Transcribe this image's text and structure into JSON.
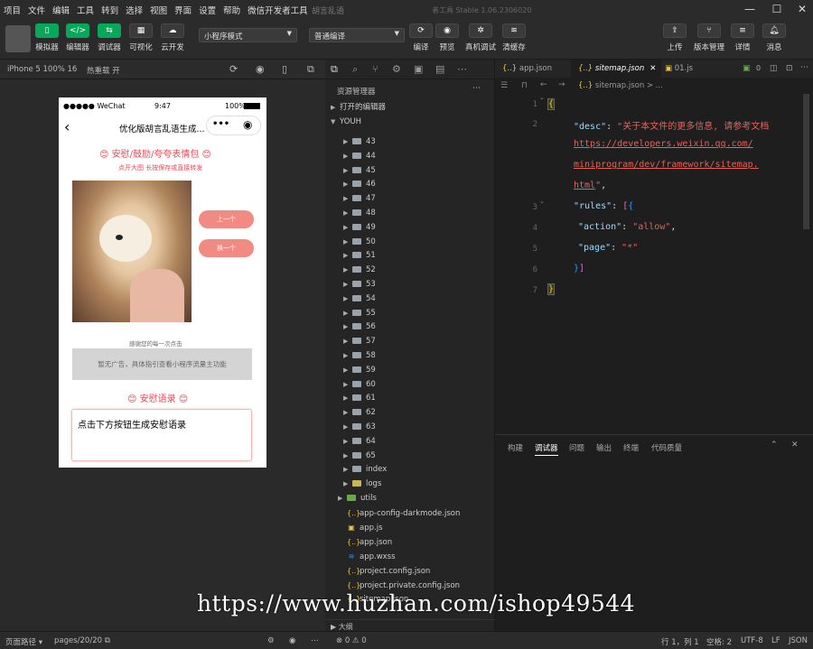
{
  "menu": [
    "项目",
    "文件",
    "编辑",
    "工具",
    "转到",
    "选择",
    "视图",
    "界面",
    "设置",
    "帮助",
    "微信开发者工具"
  ],
  "window_title": "胡言乱语",
  "version": "者工具 Stable 1.06.2306020",
  "toolbar": {
    "buttons": [
      {
        "label": "模拟器",
        "icon": "phone-icon"
      },
      {
        "label": "编辑器",
        "icon": "code-icon"
      },
      {
        "label": "调试器",
        "icon": "debug-icon"
      },
      {
        "label": "可视化",
        "icon": "layout-icon"
      },
      {
        "label": "云开发",
        "icon": "cloud-icon"
      }
    ],
    "mode_select": "小程序模式",
    "compile_select": "普通编译",
    "mid_buttons": [
      "编译",
      "预览",
      "真机调试",
      "清缓存"
    ],
    "right_buttons": [
      "上传",
      "版本管理",
      "详情",
      "消息"
    ]
  },
  "subbar": {
    "device": "iPhone 5 100% 16",
    "hot_reload": "热重载 开"
  },
  "phone": {
    "status_signal": "●●●●● WeChat",
    "status_time": "9:47",
    "status_battery": "100%",
    "nav_title": "优化版胡言乱语生成...",
    "heading1": "安慰/鼓励/夸夸表情包",
    "subheading": "点开大图 长按保存或直接转发",
    "btn_prev": "上一个",
    "btn_next": "换一个",
    "thanks": "感谢您的每一次点击",
    "ad_text": "暂无广告，具体指引查看小程序流量主功能",
    "heading2": "安慰语录",
    "output_text": "点击下方按钮生成安慰语录"
  },
  "explorer": {
    "title": "资源管理器",
    "open_editors": "打开的编辑器",
    "root": "YOUH",
    "folders": [
      "43",
      "44",
      "45",
      "46",
      "47",
      "48",
      "49",
      "50",
      "51",
      "52",
      "53",
      "54",
      "55",
      "56",
      "57",
      "58",
      "59",
      "60",
      "61",
      "62",
      "63",
      "64",
      "65",
      "index",
      "logs"
    ],
    "utils": "utils",
    "files": [
      "app-config-darkmode.json",
      "app.js",
      "app.json",
      "app.wxss",
      "project.config.json",
      "project.private.config.json",
      "sitemap.json"
    ],
    "outline": "大纲"
  },
  "editor": {
    "tabs": [
      "app.json",
      "sitemap.json",
      "01.js"
    ],
    "breadcrumb": "sitemap.json > ...",
    "line_numbers": [
      "1",
      "2",
      "3",
      "4",
      "5",
      "6",
      "7"
    ],
    "desc_key": "\"desc\"",
    "desc_val": "\"关于本文件的更多信息, 请参考文档",
    "url1": "https://developers.weixin.qq.com/",
    "url2": "miniprogram/dev/framework/sitemap.",
    "url3": "html",
    "rules_key": "\"rules\"",
    "action_key": "\"action\"",
    "action_val": "\"allow\"",
    "page_key": "\"page\"",
    "page_val": "\"*\""
  },
  "panel_tabs": [
    "构建",
    "调试器",
    "问题",
    "输出",
    "终端",
    "代码质量"
  ],
  "status": {
    "left": "页面路径",
    "page": "pages/20/20",
    "errors": "⊗ 0 ⚠ 0",
    "pos": "行 1，列 1",
    "spaces": "空格: 2",
    "enc": "UTF-8",
    "eol": "LF",
    "lang": "JSON"
  },
  "watermark": "https://www.huzhan.com/ishop49544"
}
